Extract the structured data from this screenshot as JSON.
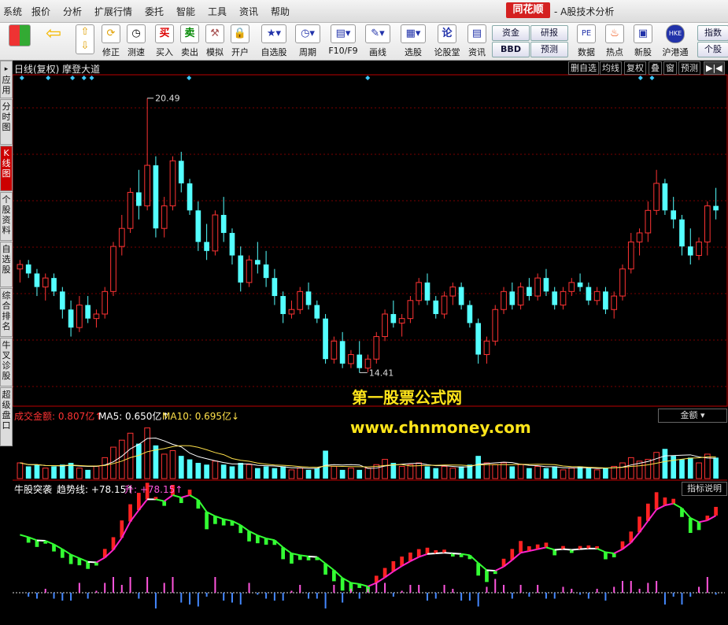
{
  "menu": {
    "items": [
      "系统",
      "报价",
      "分析",
      "扩展行情",
      "委托",
      "智能",
      "工具",
      "资讯",
      "帮助"
    ],
    "brand": "同花顺",
    "app_title": "- A股技术分析"
  },
  "toolbar": {
    "buttons": [
      {
        "label": "",
        "icon": "grid-icon"
      },
      {
        "label": "",
        "icon": "back-arrow-icon"
      },
      {
        "label": "",
        "icon": "up-down-arrows-icon"
      },
      {
        "label": "修正",
        "icon": "refresh-icon"
      },
      {
        "label": "测速",
        "icon": "clock-icon"
      },
      {
        "label": "买入",
        "icon": "buy-icon",
        "glyph": "买"
      },
      {
        "label": "卖出",
        "icon": "sell-icon",
        "glyph": "卖"
      },
      {
        "label": "模拟",
        "icon": "hammer-icon"
      },
      {
        "label": "开户",
        "icon": "lock-icon"
      },
      {
        "label": "自选股",
        "icon": "star-folder-icon"
      },
      {
        "label": "周期",
        "icon": "clock-icon"
      },
      {
        "label": "F10/F9",
        "icon": "f10-icon"
      },
      {
        "label": "画线",
        "icon": "pencil-icon"
      },
      {
        "label": "选股",
        "icon": "chart-icon"
      },
      {
        "label": "论股堂",
        "icon": "forum-icon",
        "glyph": "论"
      },
      {
        "label": "资讯",
        "icon": "news-icon"
      }
    ],
    "small_buttons": [
      "资金",
      "研报",
      "BBD",
      "预测"
    ],
    "right_buttons": [
      {
        "label": "数据",
        "icon": "pe-icon",
        "glyph": "PE"
      },
      {
        "label": "热点",
        "icon": "hot-icon"
      },
      {
        "label": "新股",
        "icon": "new-stock-icon"
      },
      {
        "label": "沪港通",
        "icon": "hk-icon",
        "glyph": "HKE"
      }
    ],
    "far_right": [
      "指数",
      "个股"
    ]
  },
  "left_tabs": [
    "应用",
    "分时图",
    "K线图",
    "个股资料",
    "自选股",
    "综合排名",
    "牛叉诊股",
    "超级盘口"
  ],
  "chart_header": {
    "title": "日线(复权) 摩登大道",
    "right_buttons": [
      "删自选",
      "均线",
      "复权",
      "叠",
      "窗",
      "预测"
    ],
    "arrow": "▶|◀"
  },
  "price_panel": {
    "high_label": "20.49",
    "low_label": "14.41"
  },
  "volume_panel": {
    "label_amount": "成交金额: 0.807亿↑",
    "label_ma5": "MA5: 0.650亿↑",
    "label_ma10": "MA10: 0.695亿↓",
    "selector": "金额"
  },
  "indicator_panel": {
    "label_name": "牛股突袭",
    "label_trend": "趋势线: +78.15↑",
    "label_rise": "升: +78.15↑",
    "help_button": "指标说明"
  },
  "watermark": {
    "line1": "第一股票公式网",
    "line2": "www.chnmoney.com"
  },
  "colors": {
    "up": "#ff3333",
    "down": "#54ffff",
    "ma5": "#ffffff",
    "ma10": "#ffe14a",
    "trend_up": "#ff22cc",
    "trend_down": "#33ff33",
    "amount_label": "#ff3333",
    "watermark": "#ffe51a"
  },
  "chart_data": {
    "type": "candlestick",
    "candles": [
      [
        16.7,
        16.9,
        16.4,
        16.8
      ],
      [
        16.8,
        16.9,
        16.5,
        16.6
      ],
      [
        16.6,
        16.7,
        16.1,
        16.3
      ],
      [
        16.3,
        16.6,
        16.0,
        16.5
      ],
      [
        16.5,
        16.6,
        16.1,
        16.2
      ],
      [
        16.2,
        16.3,
        15.6,
        15.8
      ],
      [
        15.8,
        16.0,
        15.2,
        15.4
      ],
      [
        15.4,
        16.1,
        15.3,
        15.9
      ],
      [
        15.9,
        16.1,
        15.5,
        15.6
      ],
      [
        15.6,
        15.8,
        15.4,
        15.7
      ],
      [
        15.7,
        16.3,
        15.6,
        16.2
      ],
      [
        16.2,
        17.3,
        16.1,
        17.2
      ],
      [
        17.2,
        17.9,
        17.0,
        17.6
      ],
      [
        17.6,
        18.5,
        17.5,
        18.4
      ],
      [
        18.4,
        18.9,
        17.8,
        18.1
      ],
      [
        18.1,
        20.49,
        18.0,
        19.0
      ],
      [
        19.0,
        19.2,
        17.4,
        17.6
      ],
      [
        17.6,
        18.3,
        17.4,
        18.1
      ],
      [
        18.1,
        19.2,
        18.0,
        19.1
      ],
      [
        19.1,
        19.3,
        18.4,
        18.6
      ],
      [
        18.6,
        18.7,
        17.9,
        18.0
      ],
      [
        18.0,
        18.2,
        17.1,
        17.3
      ],
      [
        17.3,
        17.7,
        16.9,
        17.1
      ],
      [
        17.1,
        18.0,
        17.0,
        17.9
      ],
      [
        17.9,
        18.3,
        17.3,
        17.5
      ],
      [
        17.5,
        17.6,
        16.8,
        17.0
      ],
      [
        17.0,
        17.2,
        16.2,
        16.4
      ],
      [
        16.4,
        17.0,
        16.3,
        16.9
      ],
      [
        16.9,
        17.3,
        16.6,
        16.8
      ],
      [
        16.8,
        17.1,
        16.3,
        16.5
      ],
      [
        16.5,
        16.7,
        15.9,
        16.1
      ],
      [
        16.1,
        16.2,
        15.5,
        15.7
      ],
      [
        15.7,
        16.0,
        15.6,
        15.8
      ],
      [
        15.8,
        16.3,
        15.7,
        16.2
      ],
      [
        16.2,
        16.4,
        15.8,
        15.9
      ],
      [
        15.9,
        16.0,
        15.5,
        15.6
      ],
      [
        15.6,
        15.7,
        14.6,
        14.7
      ],
      [
        14.7,
        15.2,
        14.6,
        15.1
      ],
      [
        15.1,
        15.3,
        14.5,
        14.6
      ],
      [
        14.6,
        14.9,
        14.5,
        14.8
      ],
      [
        14.8,
        15.1,
        14.4,
        14.5
      ],
      [
        14.5,
        14.8,
        14.41,
        14.7
      ],
      [
        14.7,
        15.3,
        14.6,
        15.2
      ],
      [
        15.2,
        15.8,
        15.1,
        15.7
      ],
      [
        15.7,
        16.0,
        15.4,
        15.5
      ],
      [
        15.5,
        15.7,
        15.2,
        15.6
      ],
      [
        15.6,
        16.1,
        15.5,
        16.0
      ],
      [
        16.0,
        16.5,
        15.9,
        16.4
      ],
      [
        16.4,
        16.6,
        15.9,
        16.0
      ],
      [
        16.0,
        16.1,
        15.6,
        15.7
      ],
      [
        15.7,
        16.2,
        15.6,
        16.1
      ],
      [
        16.1,
        16.4,
        15.9,
        16.3
      ],
      [
        16.3,
        16.4,
        15.8,
        15.9
      ],
      [
        15.9,
        16.0,
        15.4,
        15.5
      ],
      [
        15.5,
        15.6,
        14.6,
        14.8
      ],
      [
        14.8,
        15.2,
        14.6,
        15.1
      ],
      [
        15.1,
        15.9,
        15.0,
        15.8
      ],
      [
        15.8,
        16.3,
        15.7,
        16.2
      ],
      [
        16.2,
        16.4,
        15.8,
        15.9
      ],
      [
        15.9,
        16.4,
        15.8,
        16.3
      ],
      [
        16.3,
        16.5,
        16.0,
        16.1
      ],
      [
        16.1,
        16.6,
        16.0,
        16.5
      ],
      [
        16.5,
        16.7,
        16.1,
        16.2
      ],
      [
        16.2,
        16.3,
        15.8,
        15.9
      ],
      [
        15.9,
        16.3,
        15.8,
        16.2
      ],
      [
        16.2,
        16.5,
        16.1,
        16.4
      ],
      [
        16.4,
        16.6,
        16.2,
        16.3
      ],
      [
        16.3,
        16.4,
        15.9,
        16.0
      ],
      [
        16.0,
        16.3,
        15.9,
        16.2
      ],
      [
        16.2,
        16.3,
        15.7,
        15.8
      ],
      [
        15.8,
        16.2,
        15.6,
        16.1
      ],
      [
        16.1,
        16.8,
        16.0,
        16.7
      ],
      [
        16.7,
        17.5,
        16.6,
        17.3
      ],
      [
        17.3,
        17.6,
        17.0,
        17.5
      ],
      [
        17.5,
        18.2,
        17.3,
        18.0
      ],
      [
        18.0,
        18.9,
        17.9,
        18.6
      ],
      [
        18.6,
        18.7,
        17.9,
        18.0
      ],
      [
        18.0,
        18.3,
        17.6,
        17.8
      ],
      [
        17.8,
        17.9,
        17.0,
        17.2
      ],
      [
        17.2,
        17.6,
        16.8,
        17.0
      ],
      [
        17.0,
        17.4,
        16.9,
        17.3
      ],
      [
        17.3,
        18.2,
        17.0,
        18.1
      ],
      [
        18.1,
        18.5,
        17.8,
        18.0
      ]
    ],
    "volume": [
      0.9,
      0.7,
      0.8,
      0.6,
      0.7,
      0.8,
      0.9,
      0.6,
      0.5,
      0.7,
      1.2,
      1.8,
      2.2,
      2.6,
      2.0,
      2.9,
      1.9,
      1.4,
      1.6,
      1.3,
      1.1,
      0.9,
      0.8,
      1.0,
      0.8,
      0.7,
      0.9,
      0.8,
      0.6,
      0.7,
      0.6,
      0.7,
      0.5,
      0.6,
      0.5,
      0.6,
      1.6,
      0.7,
      0.5,
      0.6,
      0.5,
      0.6,
      0.8,
      1.1,
      0.9,
      0.7,
      0.8,
      0.9,
      0.7,
      0.6,
      0.7,
      0.6,
      0.7,
      0.8,
      1.3,
      0.9,
      0.8,
      0.9,
      0.7,
      0.8,
      0.6,
      0.7,
      0.6,
      0.7,
      0.5,
      0.6,
      0.7,
      0.6,
      0.5,
      0.6,
      0.7,
      0.9,
      1.2,
      1.0,
      1.1,
      1.5,
      1.7,
      1.3,
      1.1,
      1.2,
      0.9,
      1.4,
      1.2
    ]
  }
}
